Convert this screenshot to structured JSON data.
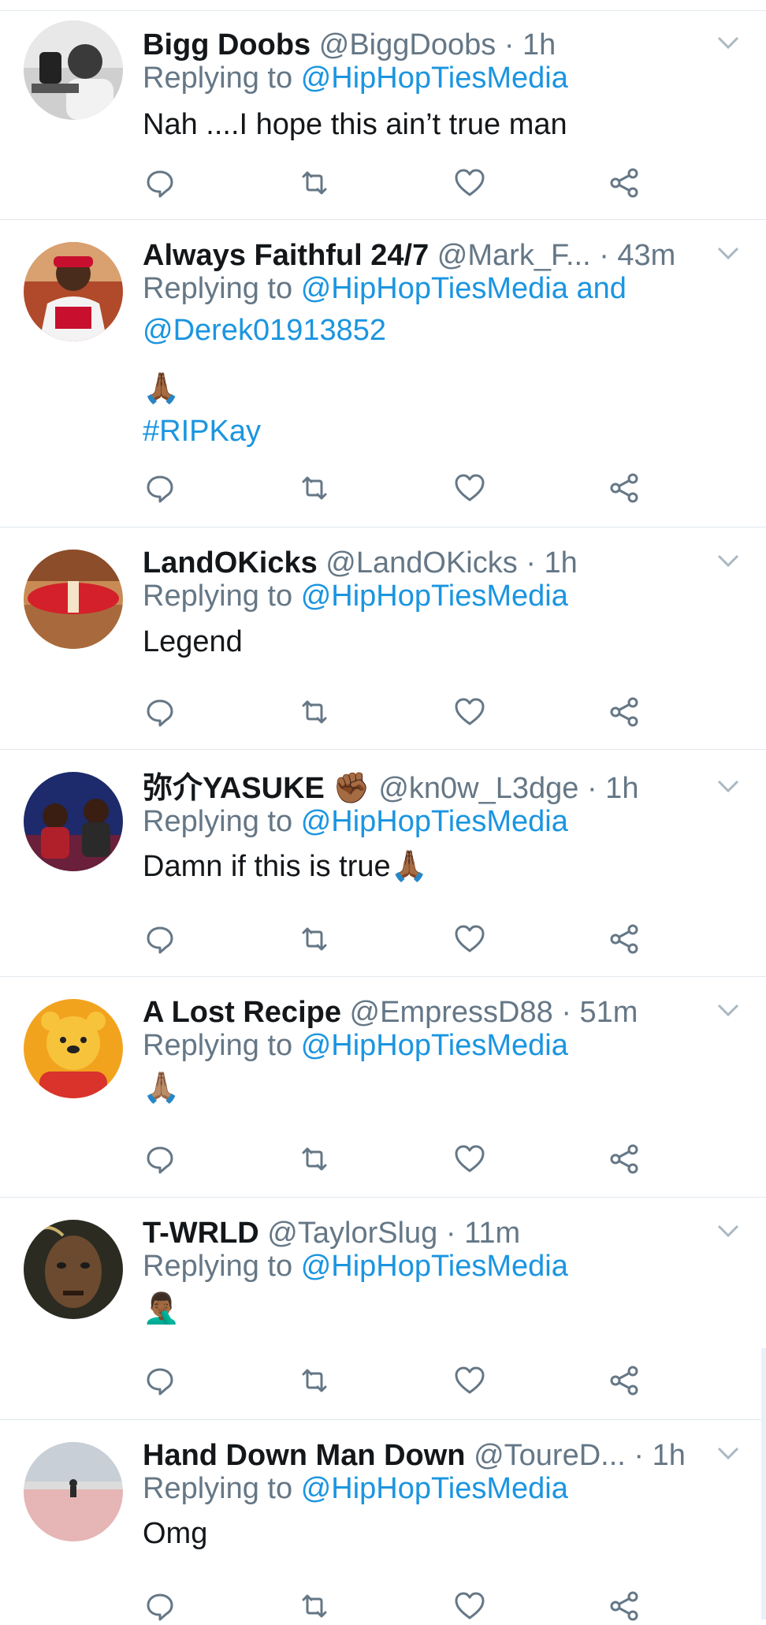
{
  "replying_to_label": "Replying to",
  "tweets": [
    {
      "name": "Bigg Doobs",
      "handle": "@BiggDoobs",
      "time": "· 1h",
      "reply_to": "@HipHopTiesMedia",
      "reply_to_2": "",
      "text": "Nah ....I hope this ain’t true man",
      "hashtag": ""
    },
    {
      "name": "Always Faithful 24/7",
      "handle": "@Mark_F...",
      "time": "· 43m",
      "reply_to": "@HipHopTiesMedia",
      "reply_conj": "and",
      "reply_to_2": "@Derek01913852",
      "text": "🙏🏾",
      "hashtag": "#RIPKay"
    },
    {
      "name": "LandOKicks",
      "handle": "@LandOKicks",
      "time": "· 1h",
      "reply_to": "@HipHopTiesMedia",
      "reply_to_2": "",
      "text": "Legend",
      "hashtag": ""
    },
    {
      "name": "弥介YASUKE ✊🏾",
      "handle": "@kn0w_L3dge",
      "time": "· 1h",
      "reply_to": "@HipHopTiesMedia",
      "reply_to_2": "",
      "text": "Damn if this is true🙏🏾",
      "hashtag": ""
    },
    {
      "name": "A Lost Recipe",
      "handle": "@EmpressD88",
      "time": "· 51m",
      "reply_to": "@HipHopTiesMedia",
      "reply_to_2": "",
      "text": "🙏🏽",
      "hashtag": ""
    },
    {
      "name": "T-WRLD",
      "handle": "@TaylorSlug",
      "time": "· 11m",
      "reply_to": "@HipHopTiesMedia",
      "reply_to_2": "",
      "text": "🤦🏾‍♂️",
      "hashtag": ""
    },
    {
      "name": "Hand Down Man Down",
      "handle": "@ToureD...",
      "time": "· 1h",
      "reply_to": "@HipHopTiesMedia",
      "reply_to_2": "",
      "text": "Omg",
      "hashtag": ""
    }
  ],
  "icons": {
    "reply": "reply-icon",
    "retweet": "retweet-icon",
    "like": "heart-icon",
    "share": "share-icon",
    "caret": "chevron-down-icon"
  },
  "colors": {
    "link": "#1b95e0",
    "meta": "#657786",
    "text": "#14171a",
    "icon": "#657786",
    "divider": "#e1e8ed"
  }
}
